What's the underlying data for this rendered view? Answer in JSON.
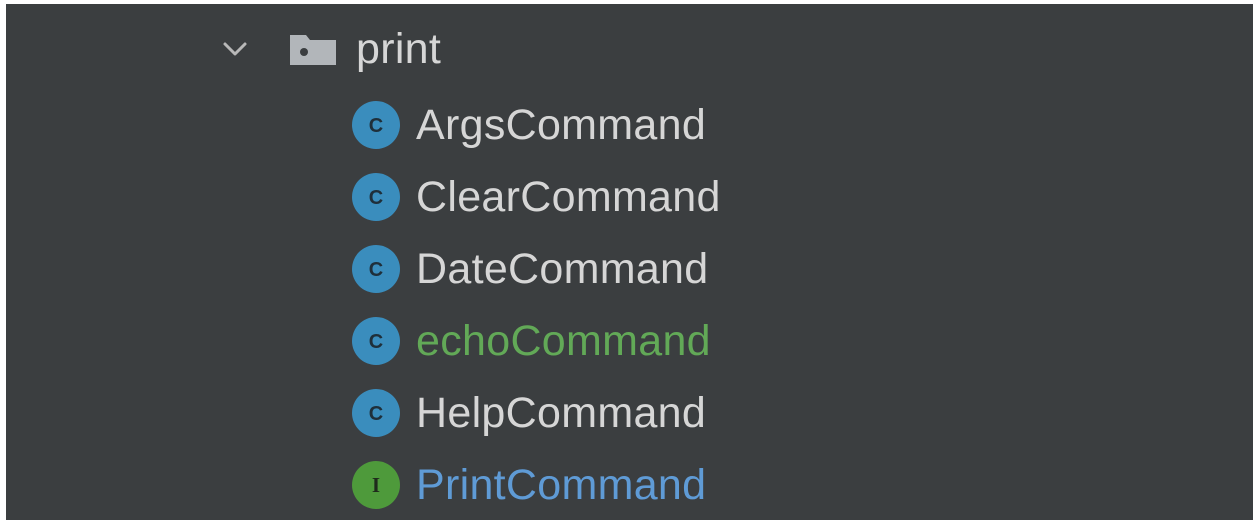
{
  "tree": {
    "folder": {
      "name": "print",
      "expanded": true,
      "icon": "folder-icon",
      "text_color": "#d6d6d6"
    },
    "items": [
      {
        "label": "ArgsCommand",
        "kind": "class",
        "icon": "class-icon",
        "text_color": "#d6d6d6"
      },
      {
        "label": "ClearCommand",
        "kind": "class",
        "icon": "class-icon",
        "text_color": "#d6d6d6"
      },
      {
        "label": "DateCommand",
        "kind": "class",
        "icon": "class-icon",
        "text_color": "#d6d6d6"
      },
      {
        "label": "echoCommand",
        "kind": "class",
        "icon": "class-icon",
        "text_color": "#62a957"
      },
      {
        "label": "HelpCommand",
        "kind": "class",
        "icon": "class-icon",
        "text_color": "#d6d6d6"
      },
      {
        "label": "PrintCommand",
        "kind": "interface",
        "icon": "interface-icon",
        "text_color": "#5f9bd6"
      }
    ],
    "badges": {
      "class_letter": "C",
      "interface_letter": "I",
      "class_color": "#3a8dbd",
      "interface_color": "#4e9a3b"
    }
  }
}
